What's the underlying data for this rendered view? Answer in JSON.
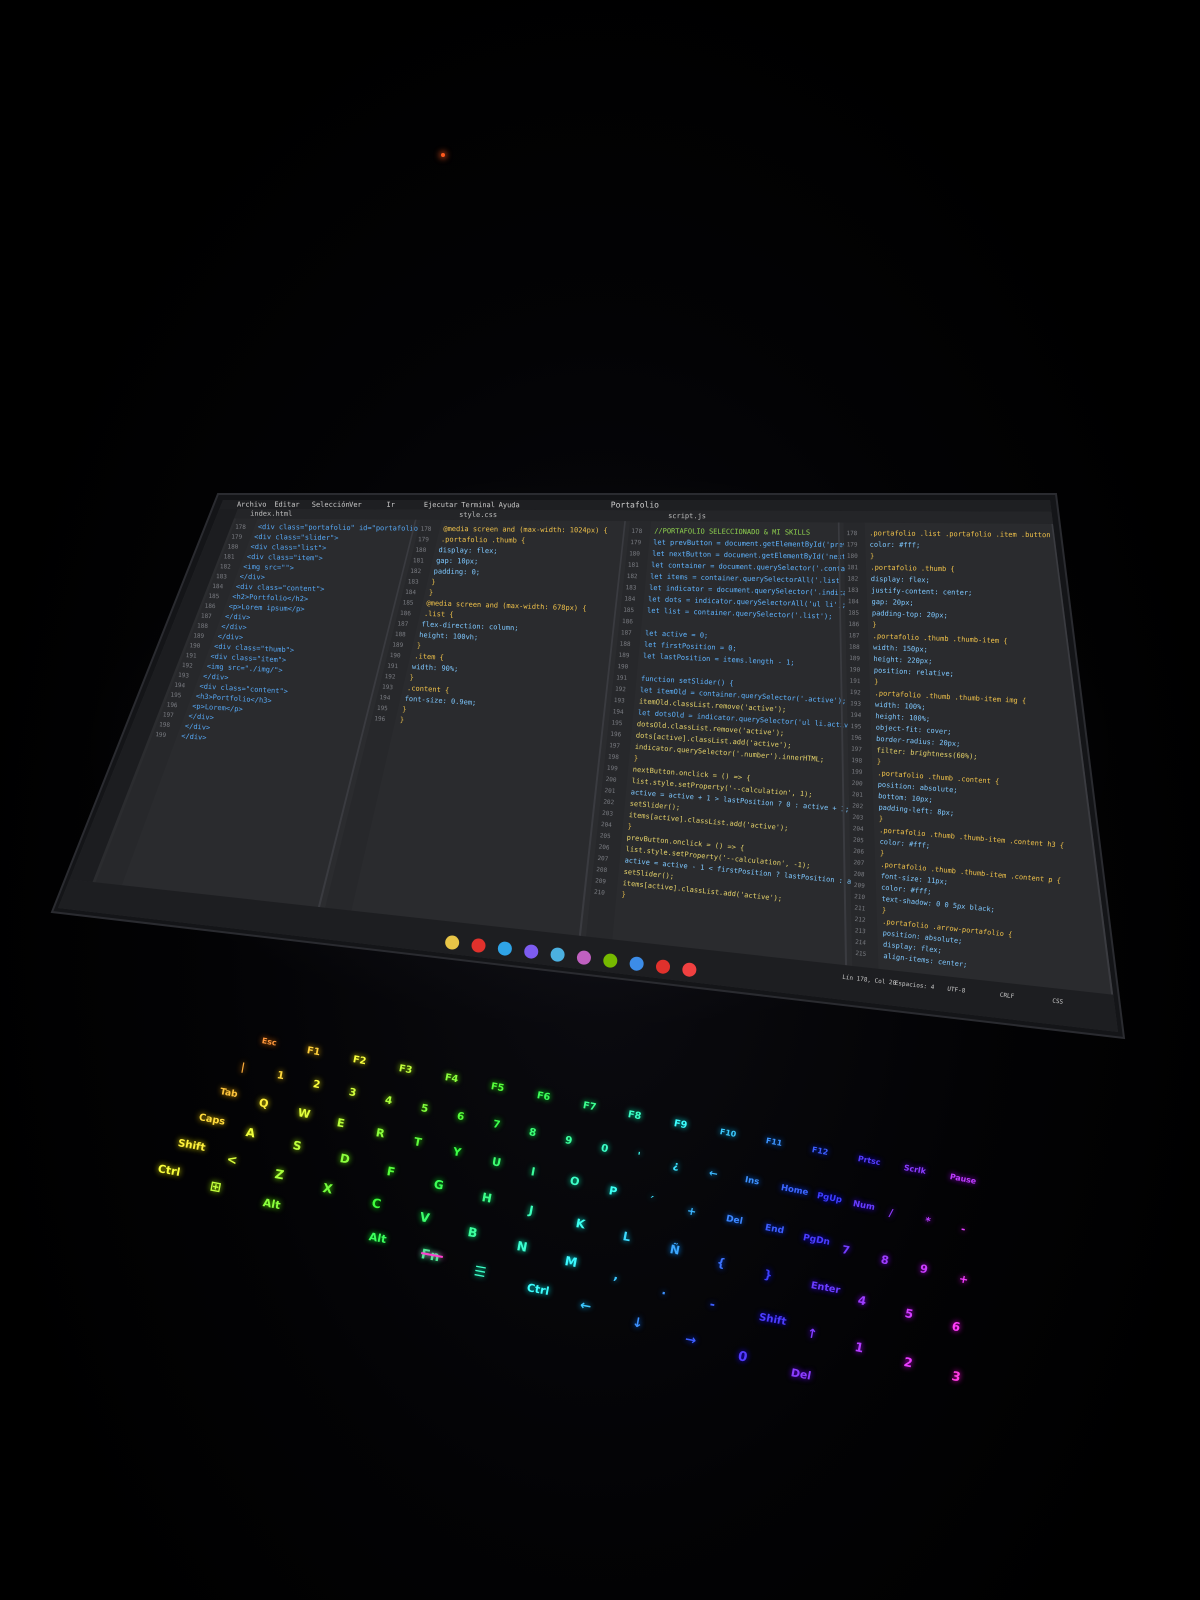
{
  "editor": {
    "menu": [
      "Archivo",
      "Editar",
      "Selección",
      "Ver",
      "Ir",
      "Ejecutar",
      "Terminal",
      "Ayuda"
    ],
    "title": "Portafolio",
    "tabs": [
      "index.html",
      "style.css",
      "script.js"
    ],
    "panes": [
      {
        "lines": [
          "<div class=\"portafolio\" id=\"portafolio\">",
          "  <div class=\"slider\">",
          "    <div class=\"list\">",
          "      <div class=\"item\">",
          "        <img src=\"\">",
          "      </div>",
          "      <div class=\"content\">",
          "        <h2>Portfolio</h2>",
          "        <p>Lorem ipsum</p>",
          "      </div>",
          "    </div>",
          "  </div>",
          "  <div class=\"thumb\">",
          "    <div class=\"item\">",
          "      <img src=\"./img/\">",
          "    </div>",
          "    <div class=\"content\">",
          "      <h3>Portfolio</h3>",
          "      <p>Lorem</p>",
          "    </div>",
          "  </div>",
          "</div>"
        ]
      },
      {
        "lines": [
          "@media screen and (max-width: 1024px) {",
          "  .portafolio .thumb {",
          "    display: flex;",
          "    gap: 10px;",
          "    padding: 0;",
          "  }",
          "}",
          "@media screen and (max-width: 678px) {",
          "  .list {",
          "    flex-direction: column;",
          "    height: 100vh;",
          "  }",
          "  .item {",
          "    width: 90%;",
          "  }",
          "  .content {",
          "    font-size: 0.9em;",
          "  }",
          "}"
        ]
      },
      {
        "lines": [
          "//PORTAFOLIO SELECCIONADO & MI SKILLS",
          "let prevButton = document.getElementById('prev');",
          "let nextButton = document.getElementById('next');",
          "let container = document.querySelector('.container');",
          "let items = container.querySelectorAll('.list .item');",
          "let indicator = document.querySelector('.indicators');",
          "let dots = indicator.querySelectorAll('ul li');",
          "let list = container.querySelector('.list');",
          "",
          "let active = 0;",
          "let firstPosition = 0;",
          "let lastPosition = items.length - 1;",
          "",
          "function setSlider() {",
          "  let itemOld = container.querySelector('.active');",
          "  itemOld.classList.remove('active');",
          "  let dotsOld = indicator.querySelector('ul li.active');",
          "  dotsOld.classList.remove('active');",
          "  dots[active].classList.add('active');",
          "  indicator.querySelector('.number').innerHTML;",
          "}",
          "nextButton.onclick = () => {",
          "  list.style.setProperty('--calculation', 1);",
          "  active = active + 1 > lastPosition ? 0 : active + 1;",
          "  setSlider();",
          "  items[active].classList.add('active');",
          "}",
          "prevButton.onclick = () => {",
          "  list.style.setProperty('--calculation', -1);",
          "  active = active - 1 < firstPosition ? lastPosition : active - 1;",
          "  setSlider();",
          "  items[active].classList.add('active');",
          "}"
        ]
      },
      {
        "lines": [
          ".portafolio .list .portafolio .item .button {",
          "  color: #fff;",
          "}",
          ".portafolio .thumb {",
          "  display: flex;",
          "  justify-content: center;",
          "  gap: 20px;",
          "  padding-top: 20px;",
          "}",
          ".portafolio .thumb .thumb-item {",
          "  width: 150px;",
          "  height: 220px;",
          "  position: relative;",
          "}",
          ".portafolio .thumb .thumb-item img {",
          "  width: 100%;",
          "  height: 100%;",
          "  object-fit: cover;",
          "  border-radius: 20px;",
          "  filter: brightness(60%);",
          "}",
          ".portafolio .thumb .content {",
          "  position: absolute;",
          "  bottom: 10px;",
          "  padding-left: 8px;",
          "}",
          ".portafolio .thumb .thumb-item .content h3 {",
          "  color: #fff;",
          "}",
          ".portafolio .thumb .thumb-item .content p {",
          "  font-size: 11px;",
          "  color: #fff;",
          "  text-shadow: 0 0 5px black;",
          "}",
          ".portafolio .arrow-portafolio {",
          "  position: absolute;",
          "  display: flex;",
          "  align-items: center;"
        ]
      }
    ],
    "status_right": [
      "Lín 178, Col 20",
      "Espacios: 4",
      "UTF-8",
      "CRLF",
      "CSS"
    ],
    "taskbar_icons": [
      "folder-icon",
      "opera-icon",
      "vscode-icon",
      "discord-icon",
      "chrome-icon",
      "notes-icon",
      "nvidia-icon",
      "app-icon",
      "chrome-icon",
      "app-icon"
    ]
  },
  "keyboard": {
    "rows": [
      [
        "Esc",
        "F1",
        "F2",
        "F3",
        "F4",
        "F5",
        "F6",
        "F7",
        "F8",
        "F9",
        "F10",
        "F11",
        "F12",
        "Prtsc",
        "Scrlk",
        "Pause"
      ],
      [
        "|",
        "1",
        "2",
        "3",
        "4",
        "5",
        "6",
        "7",
        "8",
        "9",
        "0",
        "'",
        "¿",
        "←",
        "Ins",
        "Home",
        "PgUp",
        "Num",
        "/",
        "*",
        "-"
      ],
      [
        "Tab",
        "Q",
        "W",
        "E",
        "R",
        "T",
        "Y",
        "U",
        "I",
        "O",
        "P",
        "´",
        "+",
        "Del",
        "End",
        "PgDn",
        "7",
        "8",
        "9",
        "+"
      ],
      [
        "Caps",
        "A",
        "S",
        "D",
        "F",
        "G",
        "H",
        "J",
        "K",
        "L",
        "Ñ",
        "{",
        "}",
        "Enter",
        "4",
        "5",
        "6"
      ],
      [
        "Shift",
        "<",
        "Z",
        "X",
        "C",
        "V",
        "B",
        "N",
        "M",
        ",",
        ".",
        "-",
        "Shift",
        "↑",
        "1",
        "2",
        "3"
      ],
      [
        "Ctrl",
        "⊞",
        "Alt",
        "",
        "Alt",
        "Fn",
        "☰",
        "Ctrl",
        "←",
        "↓",
        "→",
        "0",
        "Del"
      ]
    ]
  }
}
